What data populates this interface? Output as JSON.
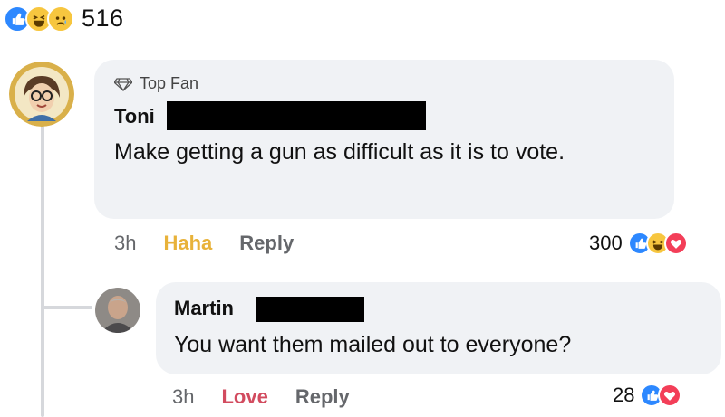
{
  "post_reactions": {
    "icons": [
      "like-icon",
      "haha-icon",
      "sad-icon"
    ],
    "count": "516"
  },
  "comments": [
    {
      "badge": "Top Fan",
      "author": "Toni",
      "text": "Make getting a gun as difficult as it is to vote.",
      "time": "3h",
      "reaction_label": "Haha",
      "reply_label": "Reply",
      "reaction_count": "300",
      "reaction_icons": [
        "like-icon",
        "haha-icon",
        "love-icon"
      ]
    },
    {
      "author": "Martin",
      "text": "You want them mailed out to everyone?",
      "time": "3h",
      "reaction_label": "Love",
      "reply_label": "Reply",
      "reaction_count": "28",
      "reaction_icons": [
        "like-icon",
        "love-icon"
      ]
    }
  ],
  "colors": {
    "like": "#2d88ff",
    "haha": "#f7c63f",
    "love": "#f33e58",
    "bubble": "#f0f2f5",
    "haha_text": "#e8b23a",
    "love_text": "#d24b5f"
  }
}
